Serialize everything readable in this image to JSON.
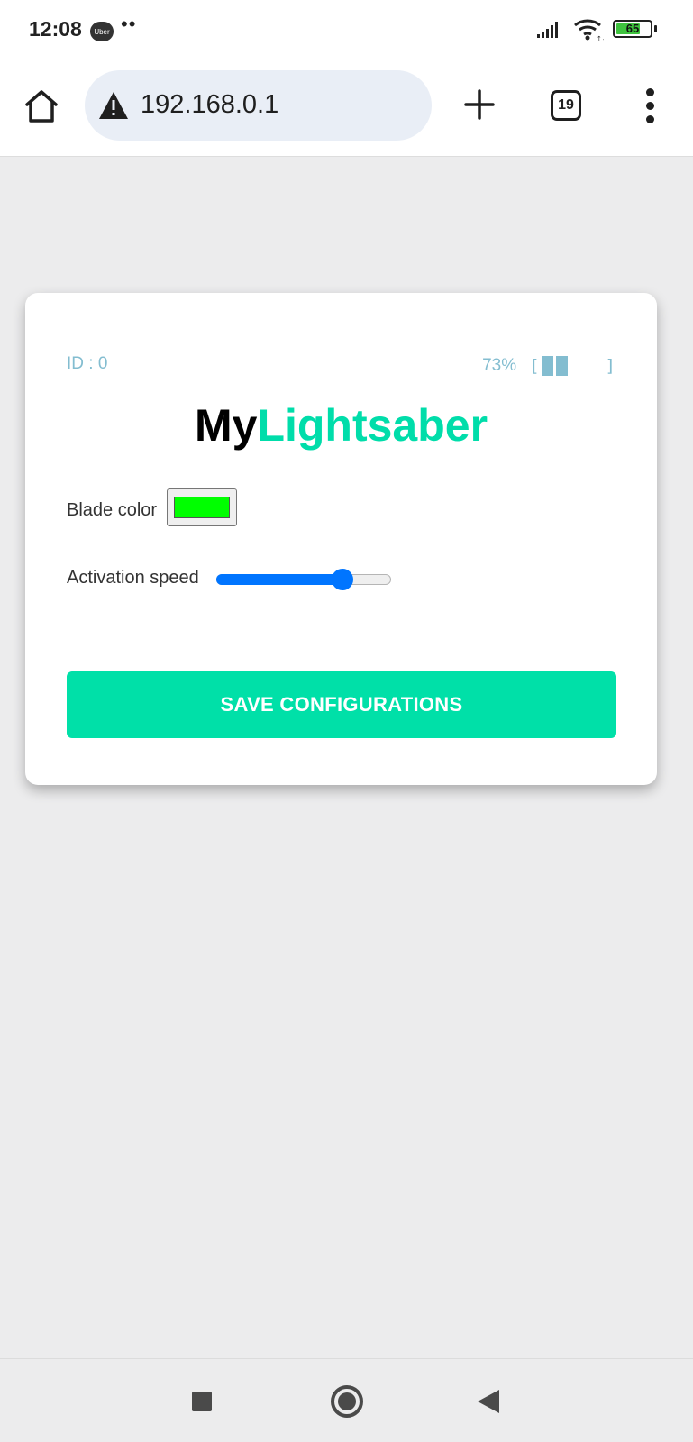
{
  "status_bar": {
    "time": "12:08",
    "notification_badge": "Uber",
    "overflow_dots": "••",
    "battery_level": "65",
    "icons": [
      "signal-icon",
      "wifi-icon",
      "battery-icon"
    ]
  },
  "browser": {
    "url": "192.168.0.1",
    "security_icon": "warning-icon",
    "tab_count": "19",
    "icons": [
      "home-icon",
      "plus-icon",
      "more-vert-icon"
    ]
  },
  "card": {
    "device_id": "ID : 0",
    "battery_percent": "73%",
    "battery_bracket_open": "[",
    "battery_bracket_close": "]",
    "battery_fraction": 0.4,
    "title_my": "My",
    "title_lightsaber": "Lightsaber",
    "blade_color_label": "Blade color",
    "blade_color_value": "#00ff00",
    "activation_speed_label": "Activation speed",
    "activation_speed_fraction": 0.72,
    "save_button": "SAVE CONFIGURATIONS"
  },
  "colors": {
    "accent": "#00ddaa",
    "info_text": "#83bdd0",
    "slider": "#0075ff"
  },
  "nav_bar": {
    "icons": [
      "recents-icon",
      "home-circle-icon",
      "back-icon"
    ]
  }
}
